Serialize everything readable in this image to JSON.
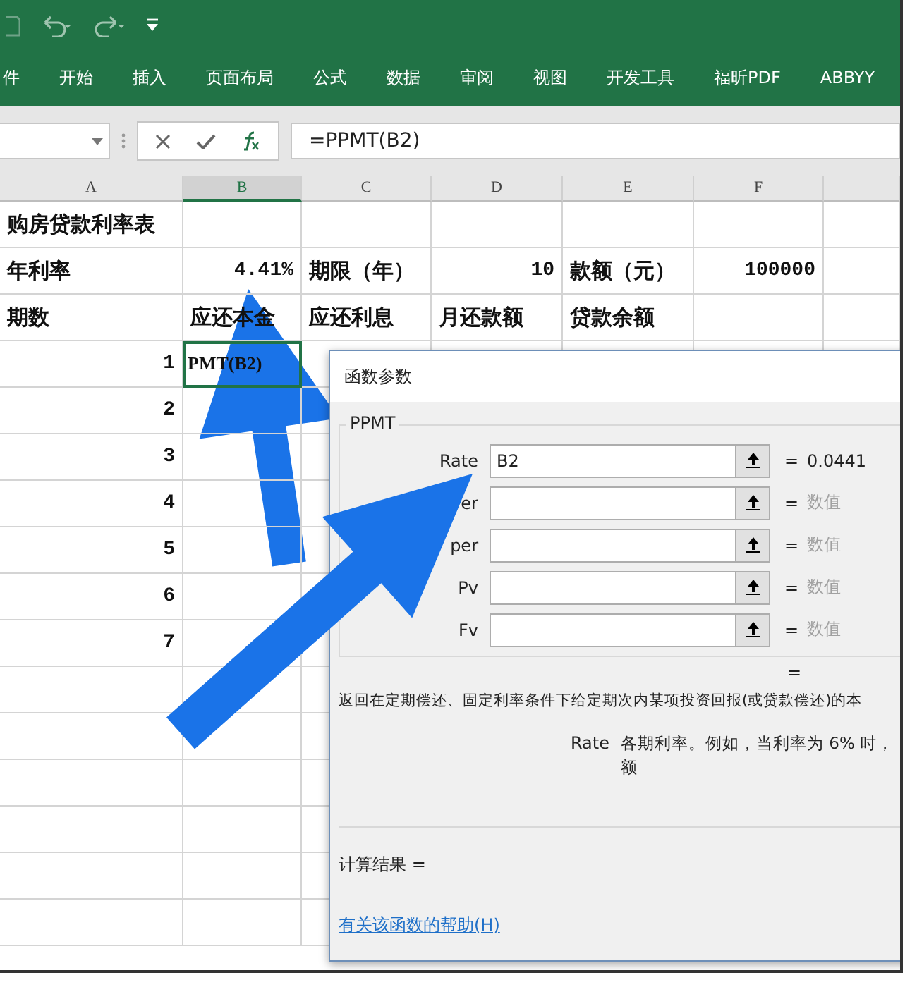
{
  "ribbon": {
    "tabs": [
      {
        "label": "件",
        "selected": false
      },
      {
        "label": "开始",
        "selected": false
      },
      {
        "label": "插入",
        "selected": false
      },
      {
        "label": "页面布局",
        "selected": false
      },
      {
        "label": "公式",
        "selected": false
      },
      {
        "label": "数据",
        "selected": false
      },
      {
        "label": "审阅",
        "selected": false
      },
      {
        "label": "视图",
        "selected": false
      },
      {
        "label": "开发工具",
        "selected": false
      },
      {
        "label": "福昕PDF",
        "selected": false
      },
      {
        "label": "ABBYY",
        "selected": false
      }
    ]
  },
  "formula_bar": {
    "formula": "=PPMT(B2)"
  },
  "sheet": {
    "columns": [
      {
        "label": "A",
        "selected": false
      },
      {
        "label": "B",
        "selected": true
      },
      {
        "label": "C",
        "selected": false
      },
      {
        "label": "D",
        "selected": false
      },
      {
        "label": "E",
        "selected": false
      },
      {
        "label": "F",
        "selected": false
      }
    ],
    "rows": [
      {
        "cells": {
          "A": {
            "text": "购房贷款利率表",
            "kind": "text",
            "selected": false
          }
        }
      },
      {
        "cells": {
          "A": {
            "text": "年利率",
            "kind": "text",
            "selected": false
          },
          "B": {
            "text": "4.41%",
            "kind": "number",
            "selected": false
          },
          "C": {
            "text": "期限（年）",
            "kind": "text",
            "selected": false
          },
          "D": {
            "text": "10",
            "kind": "number",
            "selected": false
          },
          "E": {
            "text": "款额（元）",
            "kind": "text",
            "selected": false
          },
          "F": {
            "text": "100000",
            "kind": "number",
            "selected": false
          }
        }
      },
      {
        "cells": {
          "A": {
            "text": "期数",
            "kind": "text",
            "selected": false
          },
          "B": {
            "text": "应还本金",
            "kind": "text",
            "selected": false
          },
          "C": {
            "text": "应还利息",
            "kind": "text",
            "selected": false
          },
          "D": {
            "text": "月还款额",
            "kind": "text",
            "selected": false
          },
          "E": {
            "text": "贷款余额",
            "kind": "text",
            "selected": false
          }
        }
      },
      {
        "cells": {
          "A": {
            "text": "1",
            "kind": "number",
            "selected": false
          },
          "B": {
            "text": "PMT(B2)",
            "kind": "text",
            "selected": true
          }
        }
      },
      {
        "cells": {
          "A": {
            "text": "2",
            "kind": "number",
            "selected": false
          }
        }
      },
      {
        "cells": {
          "A": {
            "text": "3",
            "kind": "number",
            "selected": false
          }
        }
      },
      {
        "cells": {
          "A": {
            "text": "4",
            "kind": "number",
            "selected": false
          }
        }
      },
      {
        "cells": {
          "A": {
            "text": "5",
            "kind": "number",
            "selected": false
          }
        }
      },
      {
        "cells": {
          "A": {
            "text": "6",
            "kind": "number",
            "selected": false
          }
        }
      },
      {
        "cells": {
          "A": {
            "text": "7",
            "kind": "number",
            "selected": false
          }
        }
      }
    ]
  },
  "dialog": {
    "title": "函数参数",
    "function_name": "PPMT",
    "arguments": [
      {
        "label": "Rate",
        "value": "B2",
        "result": "0.0441",
        "dimmed": false
      },
      {
        "label": "er",
        "result": "数值",
        "dimmed": true
      },
      {
        "label": "per",
        "result": "数值",
        "dimmed": true
      },
      {
        "label": "Pv",
        "result": "数值",
        "dimmed": true
      },
      {
        "label": "Fv",
        "result": "数值",
        "dimmed": true
      }
    ],
    "total_equals": "=",
    "description": "返回在定期偿还、固定利率条件下给定期次内某项投资回报(或贷款偿还)的本",
    "argument_help": {
      "label": "Rate",
      "lines": [
        "各期利率。例如，当利率为 6% 时，",
        "额"
      ]
    },
    "result_label": "计算结果 =",
    "help_link": "有关该函数的帮助(H)"
  }
}
